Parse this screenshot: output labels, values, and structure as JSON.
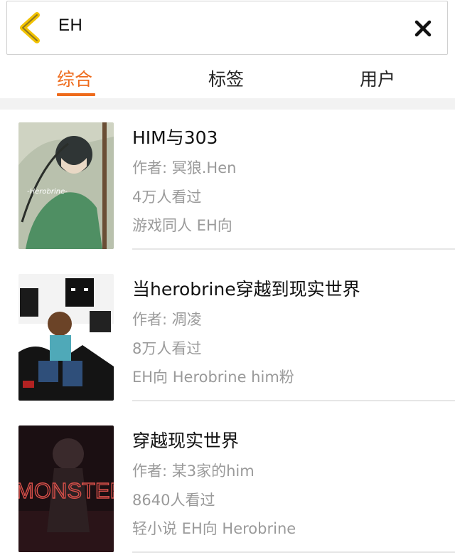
{
  "search": {
    "query": "EH"
  },
  "tabs": [
    {
      "label": "综合"
    },
    {
      "label": "标签"
    },
    {
      "label": "用户"
    }
  ],
  "results": [
    {
      "title": "HIM与303",
      "author": "作者: 冥狼.Hen",
      "views": "4万人看过",
      "tags": "游戏同人  EH向",
      "cover_text": "-Herobrine-"
    },
    {
      "title": "当herobrine穿越到现实世界",
      "author": "作者: 凋凌",
      "views": "8万人看过",
      "tags": "EH向  Herobrine  him粉"
    },
    {
      "title": "穿越现实世界",
      "author": "作者: 某3家的him",
      "views": "8640人看过",
      "tags": "轻小说  EH向  Herobrine",
      "cover_text": "MONSTER"
    }
  ],
  "colors": {
    "accent": "#ee6b1c",
    "back_arrow": "#f2c200"
  }
}
